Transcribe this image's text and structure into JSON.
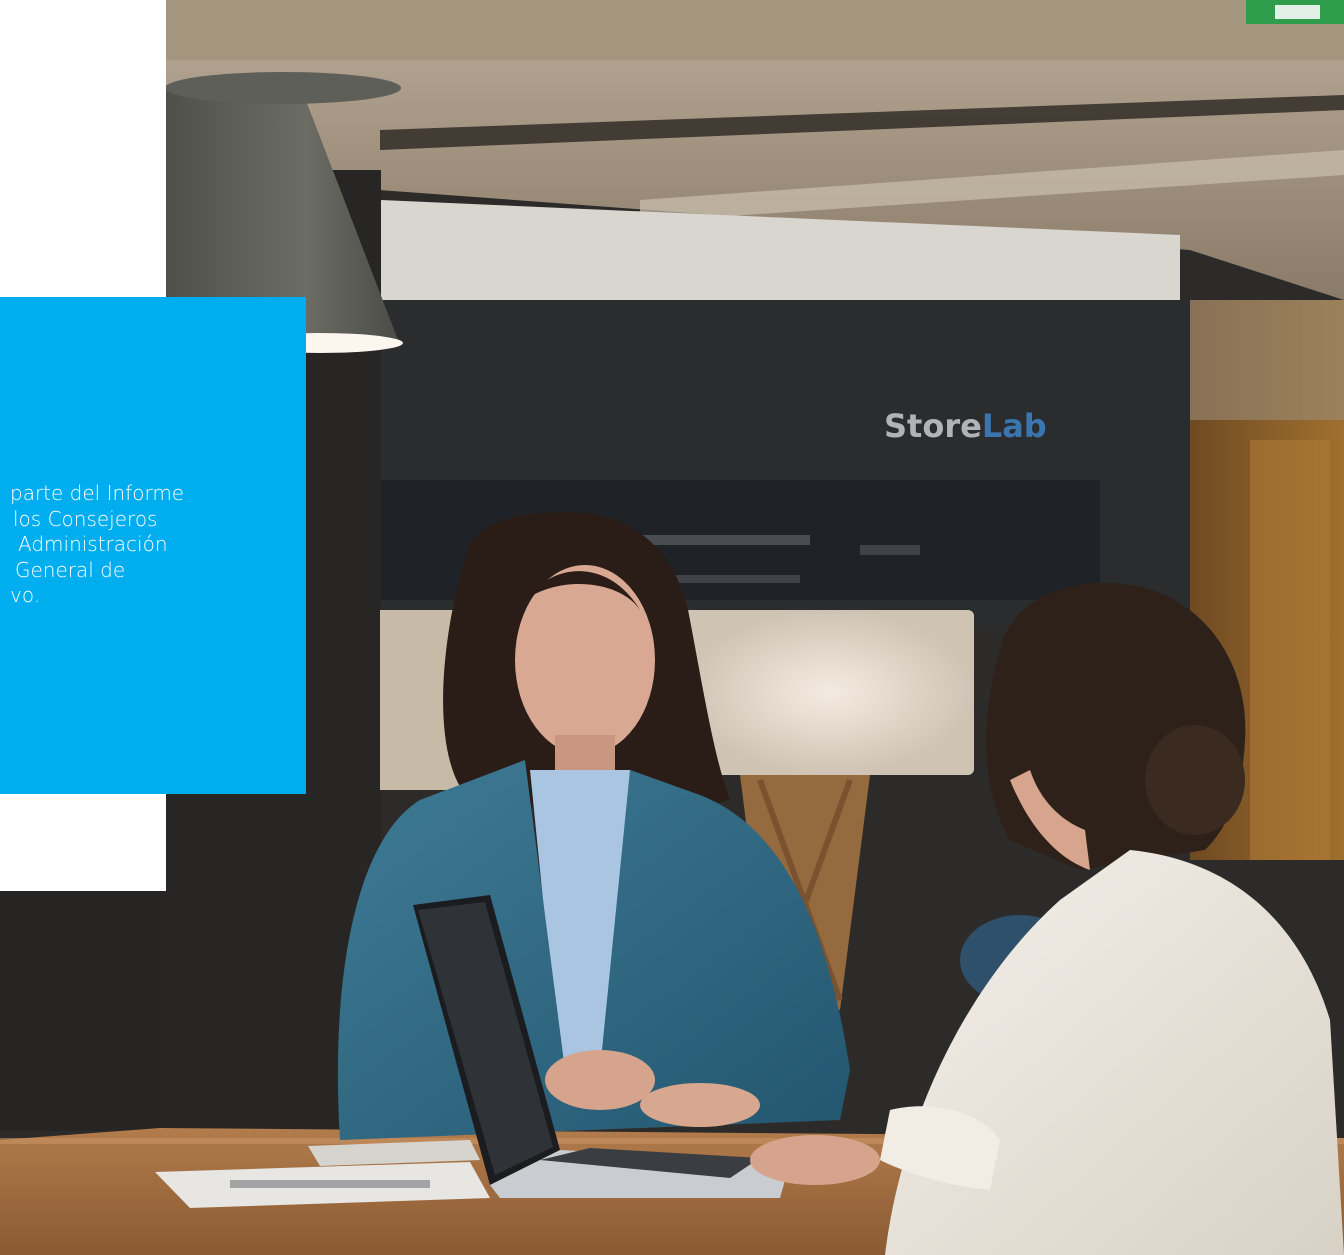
{
  "colors": {
    "accent_box": "#00aeef",
    "text_on_accent": "#ffffff",
    "panel": "#ffffff"
  },
  "intro_box": {
    "lines": [
      "parte del Informe",
      "los Consejeros",
      "Administración",
      "General de",
      "vo."
    ]
  },
  "photo": {
    "sign_text": "StoreLab"
  }
}
